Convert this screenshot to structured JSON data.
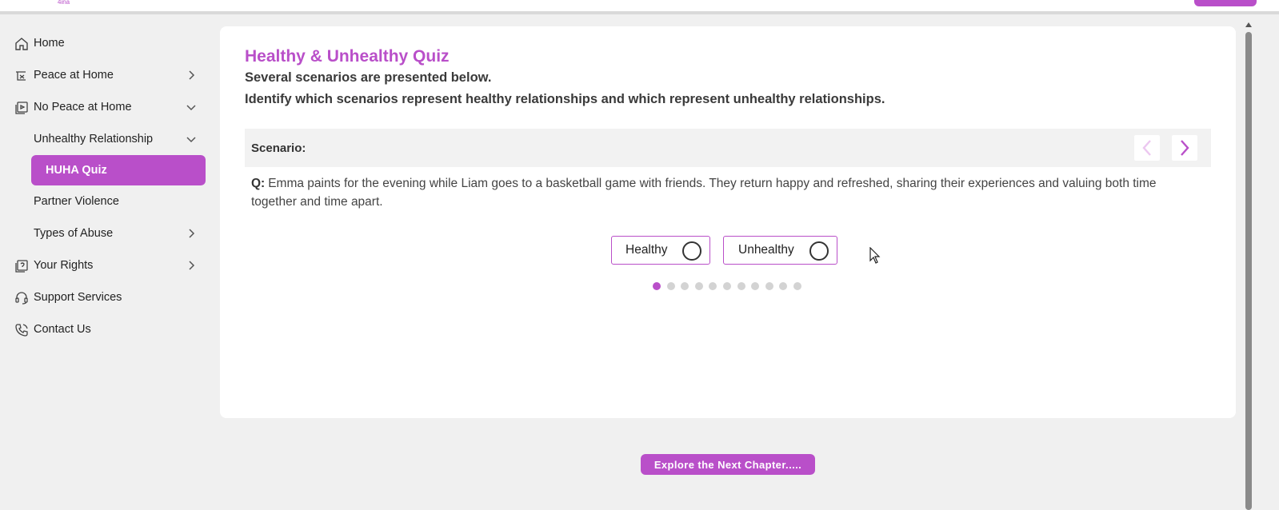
{
  "topbar": {
    "logo_text": "4ina"
  },
  "sidebar": {
    "items": [
      {
        "label": "Home"
      },
      {
        "label": "Peace at Home"
      },
      {
        "label": "No Peace at Home"
      },
      {
        "label": "Unhealthy Relationship"
      },
      {
        "label": "HUHA Quiz"
      },
      {
        "label": "Partner Violence"
      },
      {
        "label": "Types of Abuse"
      },
      {
        "label": "Your Rights"
      },
      {
        "label": "Support Services"
      },
      {
        "label": "Contact Us"
      }
    ]
  },
  "quiz": {
    "title": "Healthy & Unhealthy Quiz",
    "subtitle1": "Several scenarios are presented below.",
    "subtitle2": "Identify which scenarios represent healthy relationships and which represent unhealthy relationships.",
    "scenario_label": "Scenario:",
    "question_prefix": "Q:",
    "question_text": "Emma paints for the evening while Liam goes to a basketball game with friends. They return happy and refreshed, sharing their experiences and valuing both time together and time apart.",
    "options": [
      {
        "label": "Healthy"
      },
      {
        "label": "Unhealthy"
      }
    ],
    "total_questions": 11,
    "current_question": 1
  },
  "footer": {
    "next_chapter_label": "Explore the Next Chapter....."
  },
  "colors": {
    "accent": "#b94fc9",
    "background": "#f0f0f0",
    "card": "#ffffff"
  },
  "icons": [
    "home-icon",
    "peace-icon",
    "video-icon",
    "rights-icon",
    "support-icon",
    "phone-icon",
    "chevron-right-icon",
    "chevron-down-icon",
    "chevron-left-icon"
  ]
}
